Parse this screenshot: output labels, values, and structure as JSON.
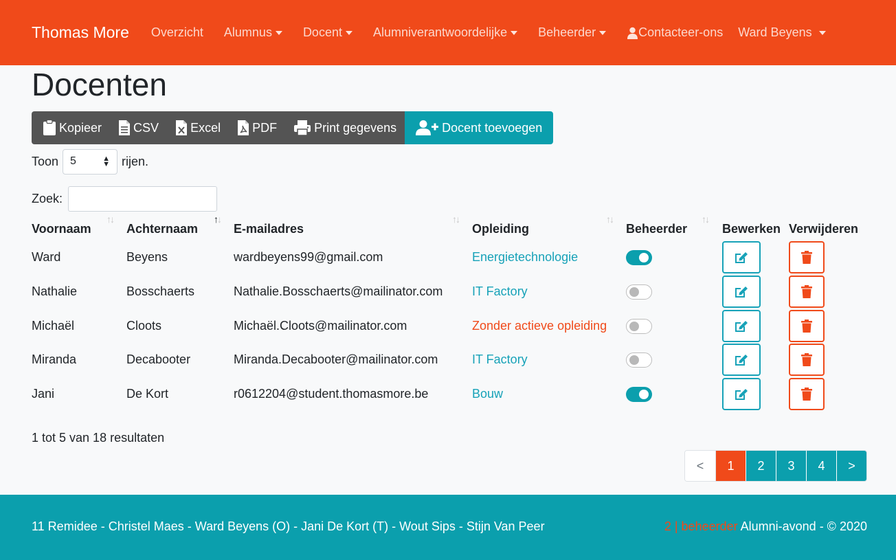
{
  "navbar": {
    "brand": "Thomas More",
    "items": [
      {
        "label": "Overzicht",
        "dropdown": false
      },
      {
        "label": "Alumnus",
        "dropdown": true
      },
      {
        "label": "Docent",
        "dropdown": true
      },
      {
        "label": "Alumniverantwoordelijke",
        "dropdown": true
      },
      {
        "label": "Beheerder",
        "dropdown": true
      }
    ],
    "contact_label": "Contacteer-ons",
    "user_label": "Ward Beyens",
    "color": "#f04a1a"
  },
  "page_title": "Docenten",
  "toolbar": {
    "copy_label": "Kopieer",
    "csv_label": "CSV",
    "excel_label": "Excel",
    "pdf_label": "PDF",
    "print_label": "Print gegevens",
    "add_label": "Docent toevoegen"
  },
  "length": {
    "prefix": "Toon",
    "value": "5",
    "suffix": "rijen."
  },
  "search": {
    "label": "Zoek:",
    "value": ""
  },
  "table": {
    "headers": {
      "firstname": "Voornaam",
      "lastname": "Achternaam",
      "email": "E-mailadres",
      "program": "Opleiding",
      "admin": "Beheerder",
      "edit": "Bewerken",
      "delete": "Verwijderen"
    },
    "rows": [
      {
        "firstname": "Ward",
        "lastname": "Beyens",
        "email": "wardbeyens99@gmail.com",
        "program": "Energietechnologie",
        "program_status": "active",
        "admin": true
      },
      {
        "firstname": "Nathalie",
        "lastname": "Bosschaerts",
        "email": "Nathalie.Bosschaerts@mailinator.com",
        "program": "IT Factory",
        "program_status": "active",
        "admin": false
      },
      {
        "firstname": "Michaël",
        "lastname": "Cloots",
        "email": "Michaël.Cloots@mailinator.com",
        "program": "Zonder actieve opleiding",
        "program_status": "none",
        "admin": false
      },
      {
        "firstname": "Miranda",
        "lastname": "Decabooter",
        "email": "Miranda.Decabooter@mailinator.com",
        "program": "IT Factory",
        "program_status": "active",
        "admin": false
      },
      {
        "firstname": "Jani",
        "lastname": "De Kort",
        "email": "r0612204@student.thomasmore.be",
        "program": "Bouw",
        "program_status": "active",
        "admin": true
      }
    ]
  },
  "info": "1 tot 5 van 18 resultaten",
  "pagination": {
    "prev": "<",
    "pages": [
      "1",
      "2",
      "3",
      "4"
    ],
    "active": "1",
    "next": ">"
  },
  "footer": {
    "left": "11 Remidee - Christel Maes - Ward Beyens (O) - Jani De Kort (T) - Wout Sips - Stijn Van Peer",
    "admin_text": "2 | beheerder",
    "right": " Alumni-avond - © 2020"
  },
  "icons": {
    "clipboard": "clipboard-icon",
    "csv": "file-text-icon",
    "excel": "file-excel-icon",
    "pdf": "file-pdf-icon",
    "print": "print-icon",
    "add_user": "user-plus-icon",
    "edit": "edit-icon",
    "trash": "trash-icon",
    "user": "user-icon"
  },
  "colors": {
    "primary": "#f04a1a",
    "accent": "#0b9fad",
    "toolbar": "#545454"
  }
}
